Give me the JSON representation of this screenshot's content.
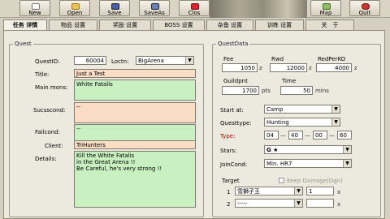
{
  "toolbar": {
    "new_label": "New",
    "open_label": "Open",
    "save_label": "Save",
    "saveas_label": "SaveAs",
    "close_label": "Clos",
    "map_label": "Map",
    "quit_label": "Quit"
  },
  "tabs": [
    "任务 详情",
    "物品 设置",
    "奖励 设置",
    "BOSS 设置",
    "杂鱼 设置",
    "训练 设置",
    "关　于"
  ],
  "quest": {
    "legend": "Quest",
    "id_label": "QuestID:",
    "id_value": "60004",
    "location_label": "Loctn:",
    "location_value": "BigArena",
    "title_label": "Title:",
    "title_value": "Just a Test",
    "main_mons_label": "Main mons:",
    "main_mons_value": "White Fatalis",
    "success_label": "Sucsscond:",
    "success_value": "--",
    "fail_label": "Failcond:",
    "fail_value": "--",
    "client_label": "Client:",
    "client_value": "TriHunters",
    "details_label": "Details:",
    "details_value": "Kill the White Fatalis\nin the Great Arena !!\nBe Careful, he's very strong !!"
  },
  "questdata": {
    "legend": "QuestData",
    "fee_label": "Fee",
    "fee_value": "1050",
    "rwd_label": "Rwd",
    "rwd_value": "12000",
    "redperko_label": "RedPerKO",
    "redperko_value": "4000",
    "z_unit": "z",
    "guildpnt_label": "Guildpnt",
    "guildpnt_value": "1700",
    "pts_unit": "pts",
    "time_label": "Time",
    "time_value": "50",
    "mins_unit": "mins",
    "startat_label": "Start at:",
    "startat_value": "Camp",
    "questtype_label": "Questtype:",
    "questtype_value": "Hunting",
    "type_label": "Type:",
    "type_values": [
      "04",
      "40",
      "00",
      "60"
    ],
    "type_sep": "—",
    "stars_label": "Stars:",
    "stars_value": "G ★",
    "joincond_label": "JoinCond:",
    "joincond_value": "Min. HR7",
    "target_label": "Target",
    "keep_damage_label": "Keep Damage(Dgn)",
    "targets": [
      {
        "index": "1",
        "monster": "雪獅子王",
        "count": "1",
        "x": "x"
      },
      {
        "index": "2",
        "monster": "-----",
        "count": "",
        "x": "x"
      }
    ]
  }
}
